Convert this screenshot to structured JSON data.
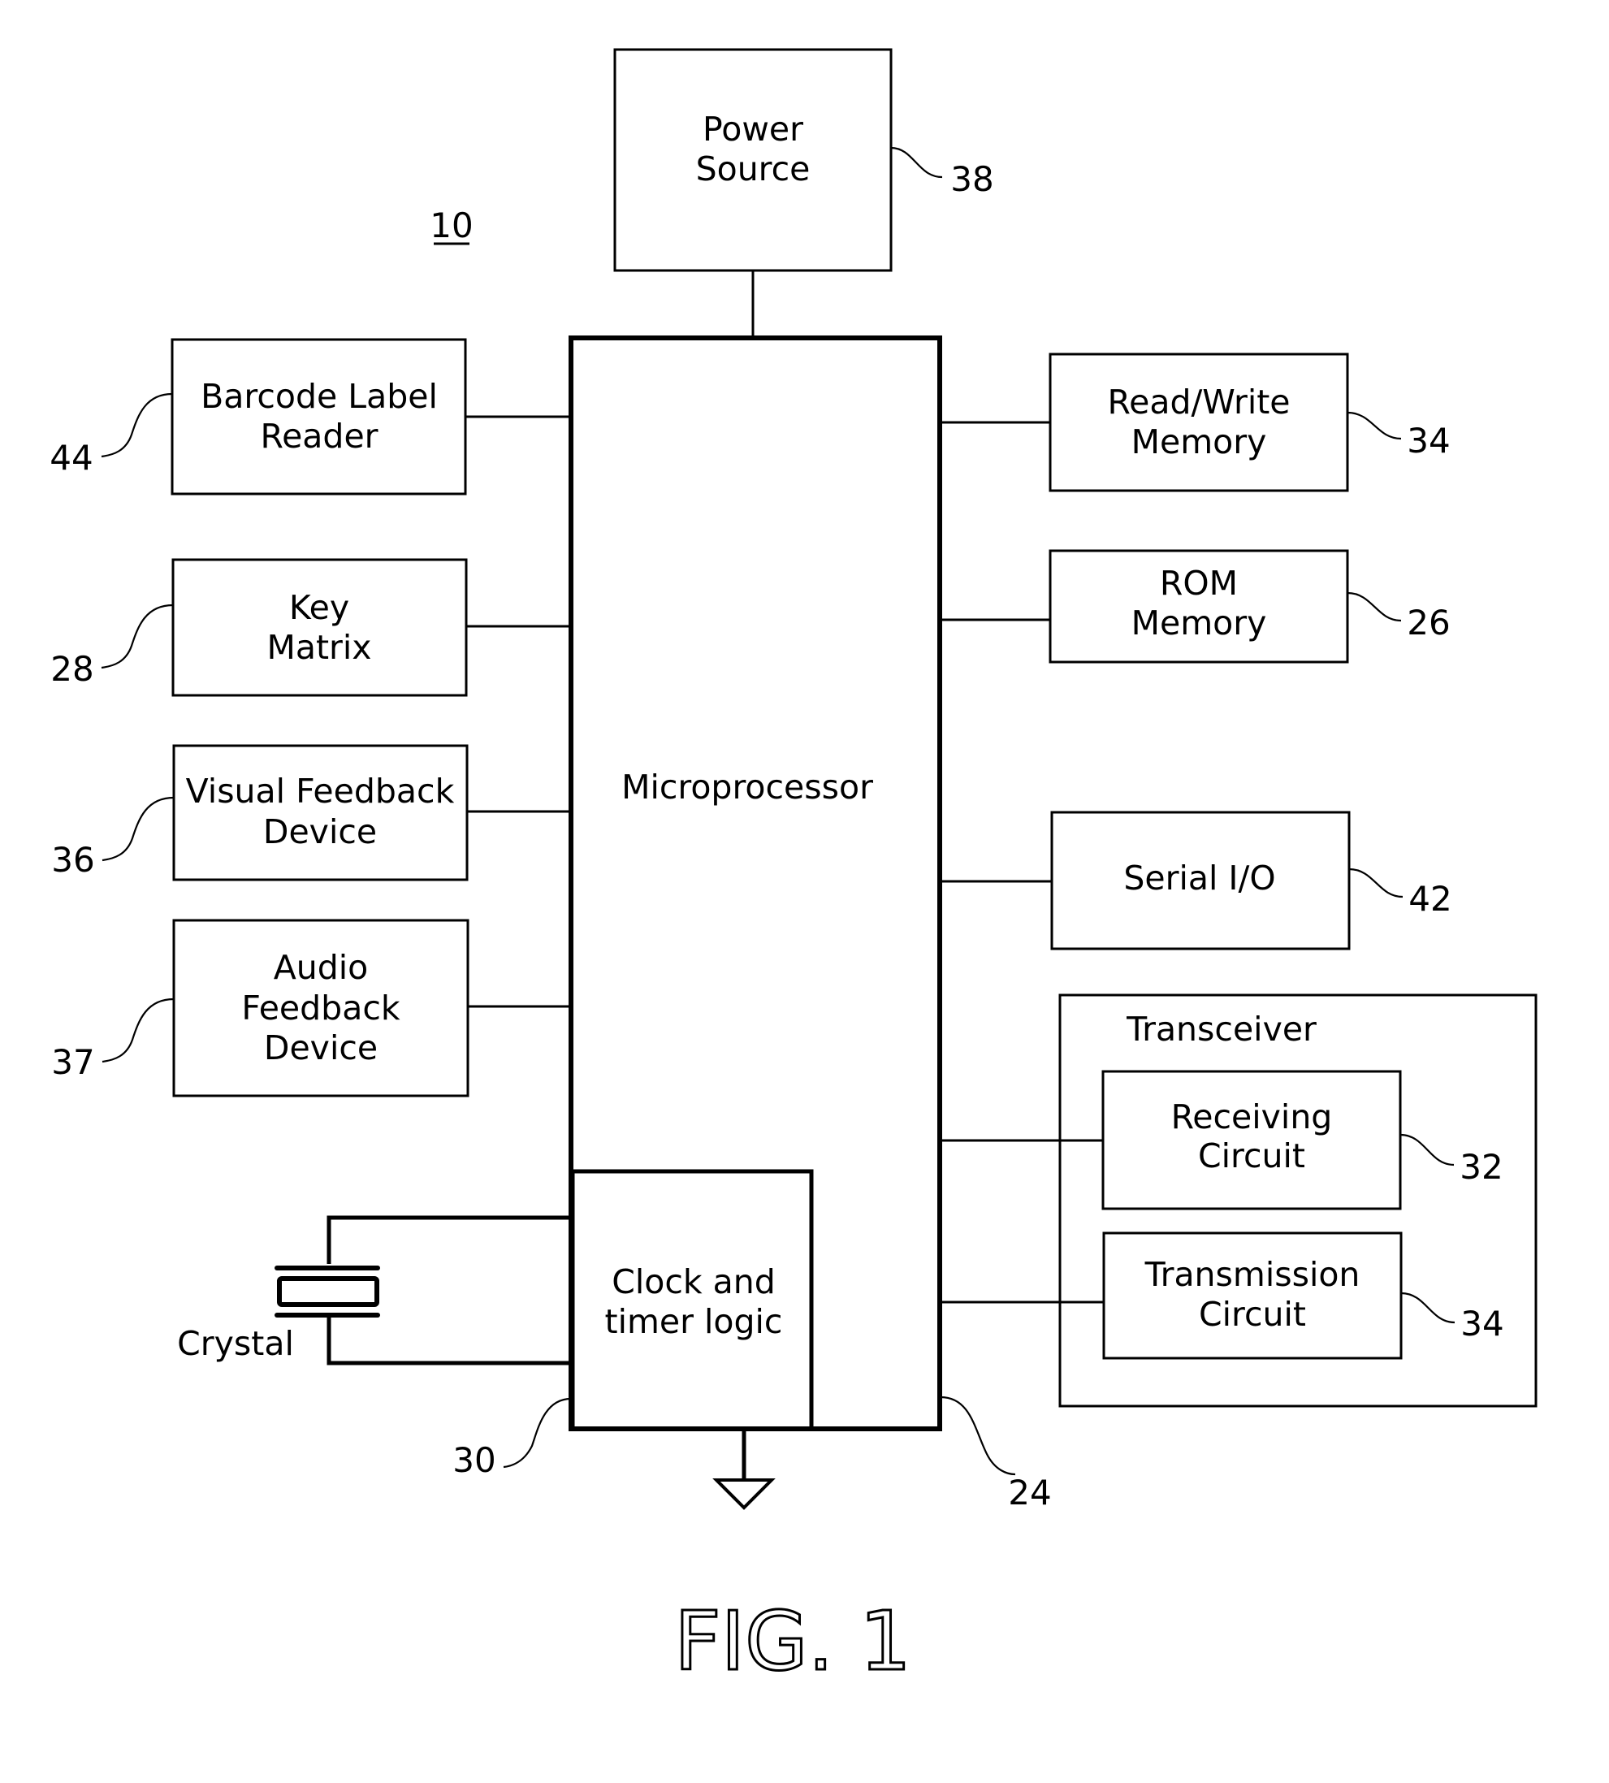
{
  "figure": {
    "caption": "FIG. 1",
    "system_ref": "10"
  },
  "blocks": {
    "power_source": {
      "lines": [
        "Power",
        "Source"
      ],
      "ref": "38"
    },
    "microprocessor": {
      "lines": [
        "Microprocessor"
      ],
      "ref": "24"
    },
    "clock_timer": {
      "lines": [
        "Clock  and",
        "timer  logic"
      ],
      "ref": "30"
    },
    "barcode_reader": {
      "lines": [
        "Barcode  Label",
        "Reader"
      ],
      "ref": "44"
    },
    "key_matrix": {
      "lines": [
        "Key",
        "Matrix"
      ],
      "ref": "28"
    },
    "visual_feedback": {
      "lines": [
        "Visual  Feedback",
        "Device"
      ],
      "ref": "36"
    },
    "audio_feedback": {
      "lines": [
        "Audio",
        "Feedback",
        "Device"
      ],
      "ref": "37"
    },
    "rw_memory": {
      "lines": [
        "Read/Write",
        "Memory"
      ],
      "ref": "34"
    },
    "rom_memory": {
      "lines": [
        "ROM",
        "Memory"
      ],
      "ref": "26"
    },
    "serial_io": {
      "lines": [
        "Serial  I/O"
      ],
      "ref": "42"
    },
    "transceiver": {
      "title": "Transceiver"
    },
    "receiving_circuit": {
      "lines": [
        "Receiving",
        "Circuit"
      ],
      "ref": "32"
    },
    "transmission_circuit": {
      "lines": [
        "Transmission",
        "Circuit"
      ],
      "ref": "34"
    },
    "crystal": {
      "label": "Crystal"
    }
  },
  "ground": {
    "symbol": "ground-icon"
  }
}
